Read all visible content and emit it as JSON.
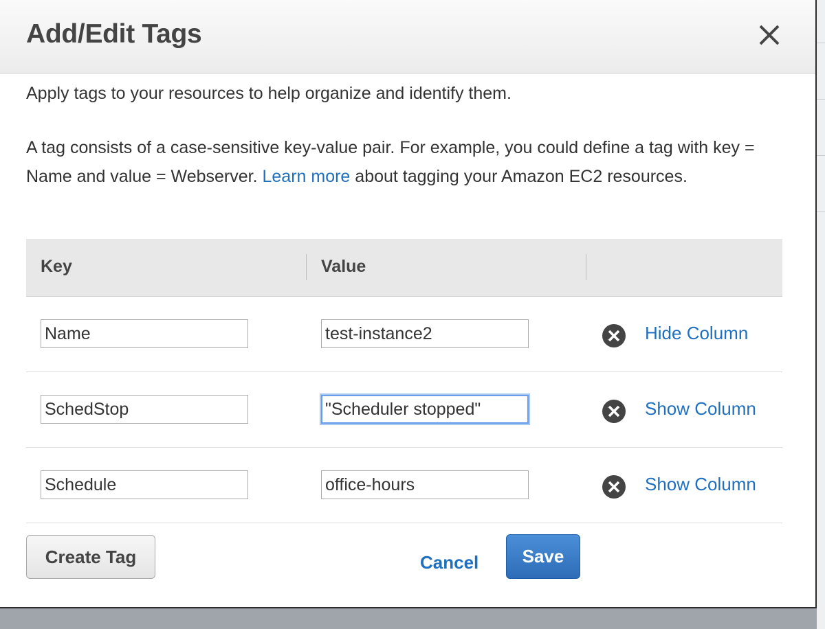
{
  "dialog": {
    "title": "Add/Edit Tags",
    "intro": "Apply tags to your resources to help organize and identify them.",
    "desc_before_link": "A tag consists of a case-sensitive key-value pair. For example, you could define a tag with key = Name and value = Webserver. ",
    "learn_more_link": "Learn more",
    "desc_after_link": " about tagging your Amazon EC2 resources."
  },
  "table": {
    "headers": {
      "key": "Key",
      "value": "Value"
    },
    "rows": [
      {
        "key": "Name",
        "value": "test-instance2",
        "column_action": "Hide Column"
      },
      {
        "key": "SchedStop",
        "value": "\"Scheduler stopped\"",
        "column_action": "Show Column",
        "focused": true
      },
      {
        "key": "Schedule",
        "value": "office-hours",
        "column_action": "Show Column"
      }
    ]
  },
  "footer": {
    "create_tag": "Create Tag",
    "cancel": "Cancel",
    "save": "Save"
  },
  "icons": {
    "close": "close-icon",
    "remove": "remove-circle-x-icon"
  },
  "colors": {
    "link": "#1f6fbf",
    "primary_button": "#2e6cb8",
    "header_bg": "#ececec"
  }
}
